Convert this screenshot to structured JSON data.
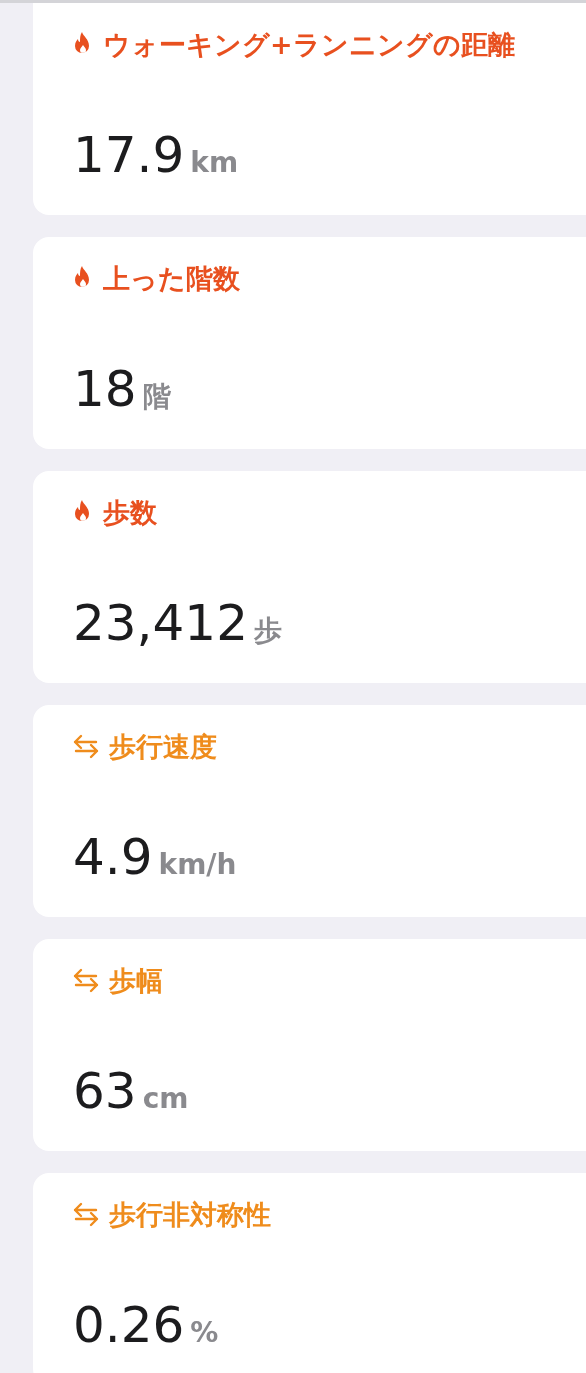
{
  "cards": [
    {
      "kind": "activity",
      "title": "ウォーキング+ランニングの距離",
      "value": "17.9",
      "unit": "km"
    },
    {
      "kind": "activity",
      "title": "上った階数",
      "value": "18",
      "unit": "階"
    },
    {
      "kind": "activity",
      "title": "歩数",
      "value": "23,412",
      "unit": "歩"
    },
    {
      "kind": "mobility",
      "title": "歩行速度",
      "value": "4.9",
      "unit": "km/h"
    },
    {
      "kind": "mobility",
      "title": "歩幅",
      "value": "63",
      "unit": "cm"
    },
    {
      "kind": "mobility",
      "title": "歩行非対称性",
      "value": "0.26",
      "unit": "%"
    }
  ]
}
